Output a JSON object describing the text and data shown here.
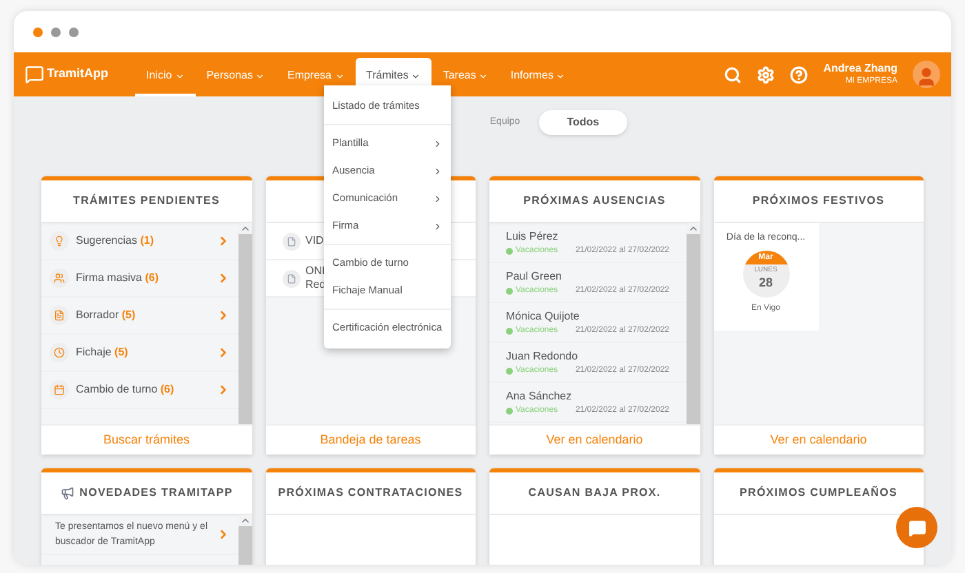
{
  "nav": {
    "logo": "TramitApp",
    "items": [
      {
        "label": "Inicio",
        "selected": true,
        "expanded": false
      },
      {
        "label": "Personas",
        "selected": false,
        "expanded": false
      },
      {
        "label": "Empresa",
        "selected": false,
        "expanded": false
      },
      {
        "label": "Trámites",
        "selected": false,
        "expanded": true
      },
      {
        "label": "Tareas",
        "selected": false,
        "expanded": false
      },
      {
        "label": "Informes",
        "selected": false,
        "expanded": false
      }
    ],
    "user": {
      "name": "Andrea Zhang",
      "company": "MI EMPRESA"
    }
  },
  "dropdown": {
    "groups": [
      [
        {
          "label": "Listado de trámites",
          "submenu": false
        }
      ],
      [
        {
          "label": "Plantilla",
          "submenu": true
        },
        {
          "label": "Ausencia",
          "submenu": true
        },
        {
          "label": "Comunicación",
          "submenu": true
        },
        {
          "label": "Firma",
          "submenu": true
        }
      ],
      [
        {
          "label": "Cambio de turno",
          "submenu": false
        },
        {
          "label": "Fichaje Manual",
          "submenu": false
        }
      ],
      [
        {
          "label": "Certificación electrónica",
          "submenu": false
        }
      ]
    ]
  },
  "filter": [
    {
      "label": "Equipo",
      "selected": false
    },
    {
      "label": "Todos",
      "selected": true
    }
  ],
  "cards": [
    {
      "kind": "tramites",
      "title": "TRÁMITES PENDIENTES",
      "footer": "Buscar trámites",
      "items": [
        {
          "label": "Sugerencias",
          "count": "(1)"
        },
        {
          "label": "Firma masiva",
          "count": "(6)"
        },
        {
          "label": "Borrador",
          "count": "(5)"
        },
        {
          "label": "Fichaje",
          "count": "(5)"
        },
        {
          "label": "Cambio de turno",
          "count": "(6)"
        }
      ]
    },
    {
      "kind": "tareas",
      "footer": "Bandeja de tareas",
      "items": [
        {
          "lines": [
            "VID"
          ]
        },
        {
          "lines": [
            "ONI",
            "Red"
          ]
        }
      ]
    },
    {
      "kind": "ausencias",
      "title": "PRÓXIMAS AUSENCIAS",
      "footer": "Ver en calendario",
      "items": [
        {
          "name": "Luis Pérez",
          "type": "Vacaciones",
          "dates": "21/02/2022 al 27/02/2022"
        },
        {
          "name": "Paul Green",
          "type": "Vacaciones",
          "dates": "21/02/2022 al 27/02/2022"
        },
        {
          "name": "Mónica Quijote",
          "type": "Vacaciones",
          "dates": "21/02/2022 al 27/02/2022"
        },
        {
          "name": "Juan Redondo",
          "type": "Vacaciones",
          "dates": "21/02/2022 al 27/02/2022"
        },
        {
          "name": "Ana Sánchez",
          "type": "Vacaciones",
          "dates": "21/02/2022 al 27/02/2022"
        }
      ]
    },
    {
      "kind": "festivos",
      "title": "PRÓXIMOS FESTIVOS",
      "footer": "Ver en calendario",
      "items": [
        {
          "name": "Día de la reconq...",
          "month": "Mar",
          "weekday": "LUNES",
          "day": "28",
          "place": "En Vigo"
        }
      ]
    },
    {
      "kind": "novedades",
      "title": "NOVEDADES TRAMITAPP",
      "items": [
        {
          "text": "Te presentamos el nuevo menú y el buscador de TramitApp"
        }
      ]
    },
    {
      "kind": "empty",
      "title": "PRÓXIMAS CONTRATACIONES"
    },
    {
      "kind": "empty",
      "title": "CAUSAN BAJA PROX."
    },
    {
      "kind": "empty",
      "title": "PRÓXIMOS CUMPLEAÑOS"
    }
  ]
}
